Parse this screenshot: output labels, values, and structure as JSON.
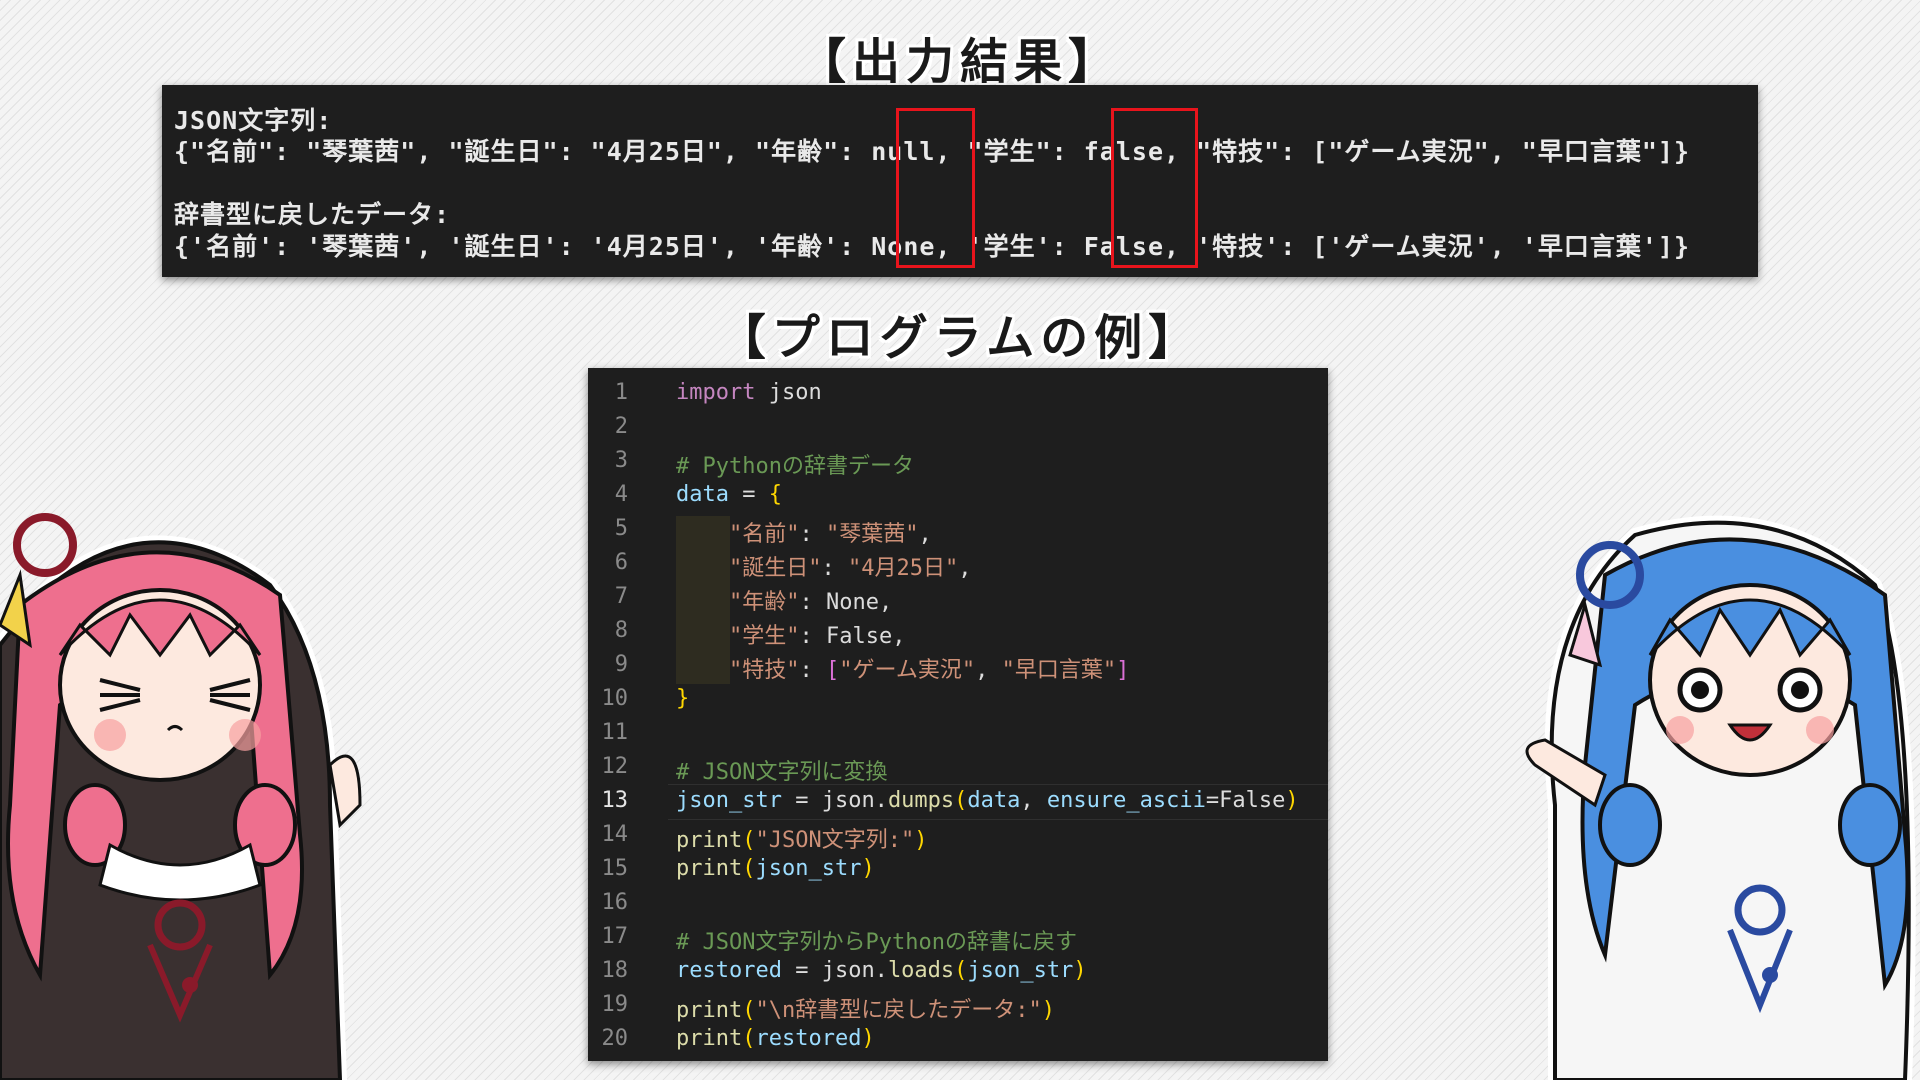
{
  "headings": {
    "output": "【出力結果】",
    "program": "【プログラムの例】"
  },
  "output": {
    "lines": [
      "JSON文字列:",
      "{\"名前\": \"琴葉茜\", \"誕生日\": \"4月25日\", \"年齢\": null, \"学生\": false, \"特技\": [\"ゲーム実況\", \"早口言葉\"]}",
      "辞書型に戻したデータ:",
      "{'名前': '琴葉茜', '誕生日': '4月25日', '年齢': None, '学生': False, '特技': ['ゲーム実況', '早口言葉']}"
    ],
    "highlight_color": "#e8141c"
  },
  "code": {
    "active_line": 13,
    "lines": [
      {
        "n": "1",
        "tokens": [
          [
            "kw",
            "import"
          ],
          [
            "tx",
            " json"
          ]
        ]
      },
      {
        "n": "2",
        "tokens": []
      },
      {
        "n": "3",
        "tokens": [
          [
            "cm",
            "# Pythonの辞書データ"
          ]
        ]
      },
      {
        "n": "4",
        "tokens": [
          [
            "vr",
            "data"
          ],
          [
            "tx",
            " = "
          ],
          [
            "br",
            "{"
          ]
        ]
      },
      {
        "n": "5",
        "tokens": [
          [
            "tx",
            "    "
          ],
          [
            "st",
            "\"名前\""
          ],
          [
            "tx",
            ": "
          ],
          [
            "st",
            "\"琴葉茜\""
          ],
          [
            "tx",
            ","
          ]
        ]
      },
      {
        "n": "6",
        "tokens": [
          [
            "tx",
            "    "
          ],
          [
            "st",
            "\"誕生日\""
          ],
          [
            "tx",
            ": "
          ],
          [
            "st",
            "\"4月25日\""
          ],
          [
            "tx",
            ","
          ]
        ]
      },
      {
        "n": "7",
        "tokens": [
          [
            "tx",
            "    "
          ],
          [
            "st",
            "\"年齢\""
          ],
          [
            "tx",
            ": None,"
          ]
        ]
      },
      {
        "n": "8",
        "tokens": [
          [
            "tx",
            "    "
          ],
          [
            "st",
            "\"学生\""
          ],
          [
            "tx",
            ": False,"
          ]
        ]
      },
      {
        "n": "9",
        "tokens": [
          [
            "tx",
            "    "
          ],
          [
            "st",
            "\"特技\""
          ],
          [
            "tx",
            ": "
          ],
          [
            "br2",
            "["
          ],
          [
            "st",
            "\"ゲーム実況\""
          ],
          [
            "tx",
            ", "
          ],
          [
            "st",
            "\"早口言葉\""
          ],
          [
            "br2",
            "]"
          ]
        ]
      },
      {
        "n": "10",
        "tokens": [
          [
            "br",
            "}"
          ]
        ]
      },
      {
        "n": "11",
        "tokens": []
      },
      {
        "n": "12",
        "tokens": [
          [
            "cm",
            "# JSON文字列に変換"
          ]
        ]
      },
      {
        "n": "13",
        "tokens": [
          [
            "vr",
            "json_str"
          ],
          [
            "tx",
            " = json."
          ],
          [
            "fn",
            "dumps"
          ],
          [
            "br",
            "("
          ],
          [
            "vr",
            "data"
          ],
          [
            "tx",
            ", "
          ],
          [
            "vr",
            "ensure_ascii"
          ],
          [
            "tx",
            "=False"
          ],
          [
            "br",
            ")"
          ]
        ]
      },
      {
        "n": "14",
        "tokens": [
          [
            "fn",
            "print"
          ],
          [
            "br",
            "("
          ],
          [
            "st",
            "\"JSON文字列:\""
          ],
          [
            "br",
            ")"
          ]
        ]
      },
      {
        "n": "15",
        "tokens": [
          [
            "fn",
            "print"
          ],
          [
            "br",
            "("
          ],
          [
            "vr",
            "json_str"
          ],
          [
            "br",
            ")"
          ]
        ]
      },
      {
        "n": "16",
        "tokens": []
      },
      {
        "n": "17",
        "tokens": [
          [
            "cm",
            "# JSON文字列からPythonの辞書に戻す"
          ]
        ]
      },
      {
        "n": "18",
        "tokens": [
          [
            "vr",
            "restored"
          ],
          [
            "tx",
            " = json."
          ],
          [
            "fn",
            "loads"
          ],
          [
            "br",
            "("
          ],
          [
            "vr",
            "json_str"
          ],
          [
            "br",
            ")"
          ]
        ]
      },
      {
        "n": "19",
        "tokens": [
          [
            "fn",
            "print"
          ],
          [
            "br",
            "("
          ],
          [
            "st",
            "\"\\n辞書型に戻したデータ:\""
          ],
          [
            "br",
            ")"
          ]
        ]
      },
      {
        "n": "20",
        "tokens": [
          [
            "fn",
            "print"
          ],
          [
            "br",
            "("
          ],
          [
            "vr",
            "restored"
          ],
          [
            "br",
            ")"
          ]
        ]
      }
    ]
  },
  "characters": {
    "left": {
      "hair": "#ee6f8e",
      "outfit": "#3a3030",
      "cord": "#8a1a2a"
    },
    "right": {
      "hair": "#4a8fe0",
      "outfit": "#f6f6f6",
      "cord": "#2a4aa0"
    }
  }
}
